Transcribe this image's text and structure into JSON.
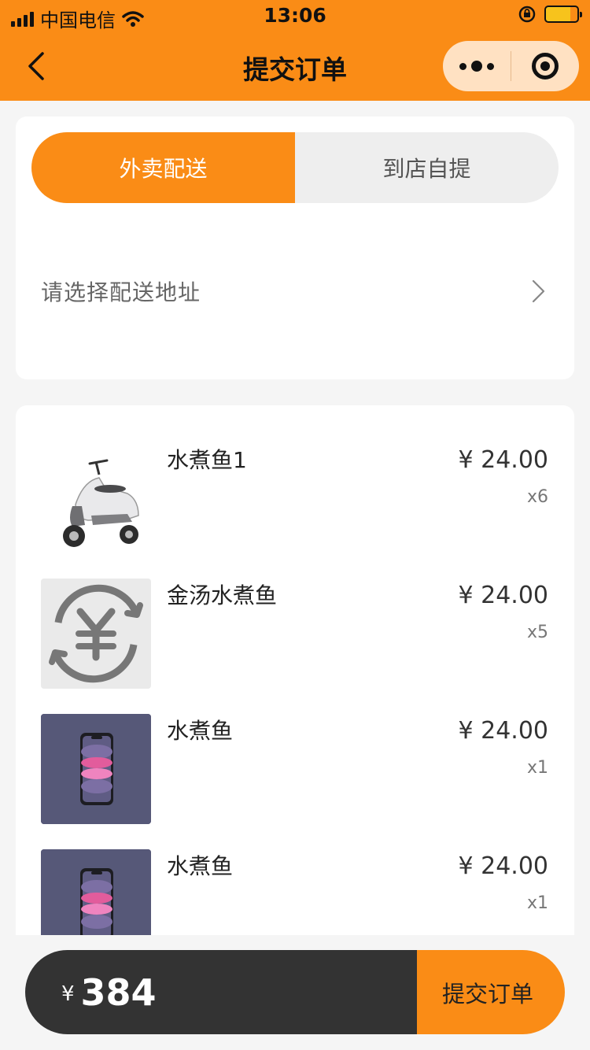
{
  "status_bar": {
    "carrier": "中国电信",
    "time": "13:06",
    "signal_icon": "signal-bars-icon",
    "wifi_icon": "wifi-icon",
    "lock_icon": "orientation-lock-icon",
    "battery_icon": "battery-charging-icon"
  },
  "nav": {
    "title": "提交订单",
    "back_icon": "chevron-left-icon",
    "more_icon": "more-dots-icon",
    "close_icon": "target-circle-icon"
  },
  "delivery": {
    "tabs": [
      {
        "label": "外卖配送",
        "active": true
      },
      {
        "label": "到店自提",
        "active": false
      }
    ],
    "address_placeholder": "请选择配送地址",
    "chevron_icon": "chevron-right-icon"
  },
  "items": [
    {
      "name": "水煮鱼1",
      "price": "¥ 24.00",
      "qty": "x6",
      "thumb": "scooter-image"
    },
    {
      "name": "金汤水煮鱼",
      "price": "¥ 24.00",
      "qty": "x5",
      "thumb": "yuan-placeholder-image"
    },
    {
      "name": "水煮鱼",
      "price": "¥ 24.00",
      "qty": "x1",
      "thumb": "phone-image"
    },
    {
      "name": "水煮鱼",
      "price": "¥ 24.00",
      "qty": "x1",
      "thumb": "phone-image"
    }
  ],
  "footer": {
    "currency": "¥",
    "total": "384",
    "submit_label": "提交订单"
  },
  "colors": {
    "accent": "#fa8c16",
    "dark": "#333333",
    "capsule": "#ffe1c2"
  }
}
